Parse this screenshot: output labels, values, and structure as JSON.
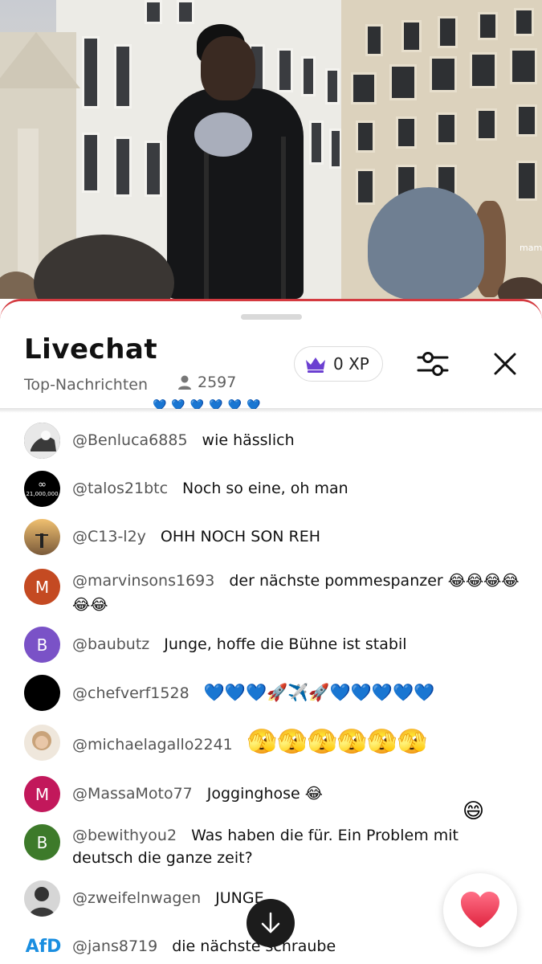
{
  "video": {
    "sign_text": "mam"
  },
  "header": {
    "title": "Livechat",
    "subtitle": "Top-Nachrichten",
    "viewer_count": "2597",
    "xp_label": "0 XP",
    "viewer_icon": "person-icon",
    "xp_icon": "crown-icon",
    "filter_icon": "sliders-icon",
    "close_icon": "close-icon"
  },
  "colors": {
    "accent_red": "#d43a40",
    "crown_purple": "#6b3fd1",
    "username_gray": "#555555"
  },
  "messages": [
    {
      "user": "@Benluca6885",
      "text": "wie hässlich",
      "avatar_letter": "",
      "avatar_color": "#2a2a2a"
    },
    {
      "user": "@talos21btc",
      "text": "Noch so eine, oh man",
      "avatar_letter": "",
      "avatar_color": "#000000",
      "avatar_caption": "21,000,000"
    },
    {
      "user": "@C13-l2y",
      "text": "OHH NOCH SON REH",
      "avatar_letter": "",
      "avatar_color": "#d99a45"
    },
    {
      "user": "@marvinsons1693",
      "text": "der nächste pommespanzer 😂😂😂😂😂😂",
      "avatar_letter": "M",
      "avatar_color": "#c44a22"
    },
    {
      "user": "@baubutz",
      "text": "Junge, hoffe die Bühne ist stabil",
      "avatar_letter": "B",
      "avatar_color": "#7a52c7"
    },
    {
      "user": "@chefverf1528",
      "text": "💙💙💙🚀✈️🚀💙💙💙💙💙",
      "avatar_letter": "",
      "avatar_color": "#000000"
    },
    {
      "user": "@michaelagallo2241",
      "text": "🫣🫣🫣🫣🫣🫣",
      "avatar_letter": "",
      "avatar_color": "#c9b08f"
    },
    {
      "user": "@MassaMoto77",
      "text": "Jogginghose 😂",
      "avatar_letter": "M",
      "avatar_color": "#c2185b"
    },
    {
      "user": "@bewithyou2",
      "text": "Was haben die für. Ein Problem mit deutsch die ganze zeit?",
      "avatar_letter": "B",
      "avatar_color": "#3d7a2a"
    },
    {
      "user": "@zweifelnwagen",
      "text": "JUNGE",
      "avatar_letter": "",
      "avatar_color": "#6a6a6a"
    },
    {
      "user": "@jans8719",
      "text": "die nächste schraube",
      "avatar_letter": "AfD",
      "avatar_color": "#1a8ee0"
    }
  ],
  "floating": {
    "emoji": "😄",
    "heart_icon": "heart-icon",
    "scroll_icon": "arrow-down-icon"
  }
}
